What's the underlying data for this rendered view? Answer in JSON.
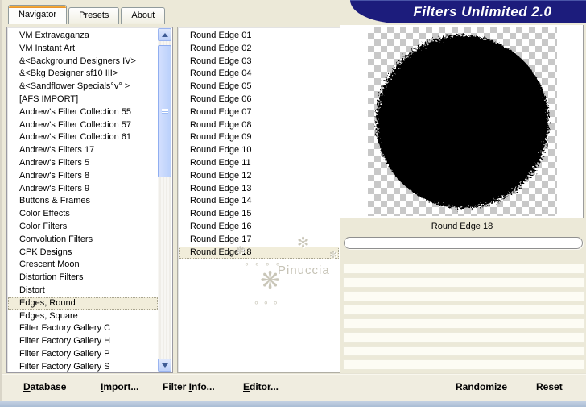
{
  "window": {
    "title": "Filters Unlimited 2.0"
  },
  "tabs": [
    {
      "label": "Navigator",
      "active": true
    },
    {
      "label": "Presets",
      "active": false
    },
    {
      "label": "About",
      "active": false
    }
  ],
  "navigator": {
    "selected_index": 21,
    "items": [
      "VM Extravaganza",
      "VM Instant Art",
      "&<Background Designers IV>",
      "&<Bkg Designer sf10 III>",
      "&<Sandflower Specials°v° >",
      "[AFS IMPORT]",
      "Andrew's Filter Collection 55",
      "Andrew's Filter Collection 57",
      "Andrew's Filter Collection 61",
      "Andrew's Filters 17",
      "Andrew's Filters 5",
      "Andrew's Filters 8",
      "Andrew's Filters 9",
      "Buttons & Frames",
      "Color Effects",
      "Color Filters",
      "Convolution Filters",
      "CPK Designs",
      "Crescent Moon",
      "Distortion Filters",
      "Distort",
      "Edges, Round",
      "Edges, Square",
      "Filter Factory Gallery C",
      "Filter Factory Gallery H",
      "Filter Factory Gallery P",
      "Filter Factory Gallery S"
    ]
  },
  "filters": {
    "selected_index": 17,
    "items": [
      "Round Edge 01",
      "Round Edge 02",
      "Round Edge 03",
      "Round Edge 04",
      "Round Edge 05",
      "Round Edge 06",
      "Round Edge 07",
      "Round Edge 08",
      "Round Edge 09",
      "Round Edge 10",
      "Round Edge 11",
      "Round Edge 12",
      "Round Edge 13",
      "Round Edge 14",
      "Round Edge 15",
      "Round Edge 16",
      "Round Edge 17",
      "Round Edge 18"
    ]
  },
  "preview": {
    "caption": "Round Edge 18"
  },
  "watermark": {
    "text": "Pinuccia"
  },
  "actions": {
    "database": {
      "pre": "",
      "key": "D",
      "post": "atabase"
    },
    "import": {
      "pre": "",
      "key": "I",
      "post": "mport..."
    },
    "filter_info": {
      "pre": "Filter ",
      "key": "I",
      "post": "nfo..."
    },
    "editor": {
      "pre": "",
      "key": "E",
      "post": "ditor..."
    },
    "randomize": "Randomize",
    "reset": "Reset"
  },
  "colors": {
    "banner_navy": "#1c1c7c",
    "dialog_background": "#ece9d8",
    "selection_highlight": "#f1edda",
    "checker_gray": "#c8c8c8",
    "tab_accent_orange": "#e68b2c",
    "scrollbar_blue": "#bed1fa",
    "desktop_strip_blue": "#a9bcd4"
  }
}
